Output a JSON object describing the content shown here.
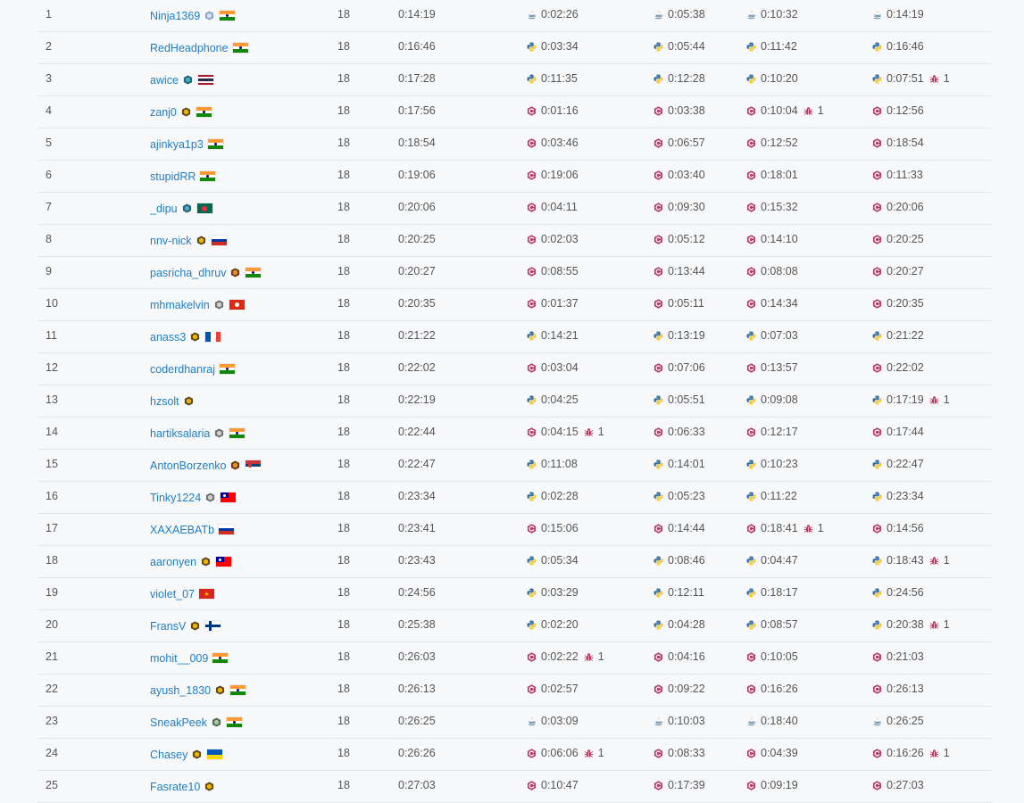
{
  "colors": {
    "link": "#1f7ec7",
    "text": "#555555",
    "bug": "#c0315a",
    "cpp": "#b83a6a",
    "python_blue": "#3572a5",
    "python_yellow": "#f7c93e",
    "java_blue": "#5382a1",
    "java_red": "#e76f00"
  },
  "icons": {
    "cpp": "cpp-language-icon",
    "python3": "python-language-icon",
    "java": "java-language-icon",
    "bug": "wrong-submission-bug-icon"
  },
  "rows": [
    {
      "rank": "1",
      "user": "Ninja1369",
      "badge": "guardian",
      "country": "in",
      "score": "18",
      "time": "0:14:19",
      "subs": [
        {
          "lang": "java",
          "t": "0:02:26",
          "bugs": ""
        },
        {
          "lang": "java",
          "t": "0:05:38",
          "bugs": ""
        },
        {
          "lang": "java",
          "t": "0:10:32",
          "bugs": ""
        },
        {
          "lang": "java",
          "t": "0:14:19",
          "bugs": ""
        }
      ]
    },
    {
      "rank": "2",
      "user": "RedHeadphone",
      "badge": "",
      "country": "in",
      "score": "18",
      "time": "0:16:46",
      "subs": [
        {
          "lang": "python3",
          "t": "0:03:34",
          "bugs": ""
        },
        {
          "lang": "python3",
          "t": "0:05:44",
          "bugs": ""
        },
        {
          "lang": "python3",
          "t": "0:11:42",
          "bugs": ""
        },
        {
          "lang": "python3",
          "t": "0:16:46",
          "bugs": ""
        }
      ]
    },
    {
      "rank": "3",
      "user": "awice",
      "badge": "teal",
      "country": "th",
      "score": "18",
      "time": "0:17:28",
      "subs": [
        {
          "lang": "python3",
          "t": "0:11:35",
          "bugs": ""
        },
        {
          "lang": "python3",
          "t": "0:12:28",
          "bugs": ""
        },
        {
          "lang": "python3",
          "t": "0:10:20",
          "bugs": ""
        },
        {
          "lang": "python3",
          "t": "0:07:51",
          "bugs": "1"
        }
      ]
    },
    {
      "rank": "4",
      "user": "zanj0",
      "badge": "gold",
      "country": "in",
      "score": "18",
      "time": "0:17:56",
      "subs": [
        {
          "lang": "cpp",
          "t": "0:01:16",
          "bugs": ""
        },
        {
          "lang": "cpp",
          "t": "0:03:38",
          "bugs": ""
        },
        {
          "lang": "cpp",
          "t": "0:10:04",
          "bugs": "1"
        },
        {
          "lang": "cpp",
          "t": "0:12:56",
          "bugs": ""
        }
      ]
    },
    {
      "rank": "5",
      "user": "ajinkya1p3",
      "badge": "",
      "country": "in",
      "score": "18",
      "time": "0:18:54",
      "subs": [
        {
          "lang": "cpp",
          "t": "0:03:46",
          "bugs": ""
        },
        {
          "lang": "cpp",
          "t": "0:06:57",
          "bugs": ""
        },
        {
          "lang": "cpp",
          "t": "0:12:52",
          "bugs": ""
        },
        {
          "lang": "cpp",
          "t": "0:18:54",
          "bugs": ""
        }
      ]
    },
    {
      "rank": "6",
      "user": "stupidRR",
      "badge": "",
      "country": "in",
      "score": "18",
      "time": "0:19:06",
      "subs": [
        {
          "lang": "cpp",
          "t": "0:19:06",
          "bugs": ""
        },
        {
          "lang": "cpp",
          "t": "0:03:40",
          "bugs": ""
        },
        {
          "lang": "cpp",
          "t": "0:18:01",
          "bugs": ""
        },
        {
          "lang": "cpp",
          "t": "0:11:33",
          "bugs": ""
        }
      ]
    },
    {
      "rank": "7",
      "user": "_dipu",
      "badge": "teal",
      "country": "bd",
      "score": "18",
      "time": "0:20:06",
      "subs": [
        {
          "lang": "cpp",
          "t": "0:04:11",
          "bugs": ""
        },
        {
          "lang": "cpp",
          "t": "0:09:30",
          "bugs": ""
        },
        {
          "lang": "cpp",
          "t": "0:15:32",
          "bugs": ""
        },
        {
          "lang": "cpp",
          "t": "0:20:06",
          "bugs": ""
        }
      ]
    },
    {
      "rank": "8",
      "user": "nnv-nick",
      "badge": "gold",
      "country": "ru",
      "score": "18",
      "time": "0:20:25",
      "subs": [
        {
          "lang": "cpp",
          "t": "0:02:03",
          "bugs": ""
        },
        {
          "lang": "cpp",
          "t": "0:05:12",
          "bugs": ""
        },
        {
          "lang": "cpp",
          "t": "0:14:10",
          "bugs": ""
        },
        {
          "lang": "cpp",
          "t": "0:20:25",
          "bugs": ""
        }
      ]
    },
    {
      "rank": "9",
      "user": "pasricha_dhruv",
      "badge": "orange",
      "country": "in",
      "score": "18",
      "time": "0:20:27",
      "subs": [
        {
          "lang": "cpp",
          "t": "0:08:55",
          "bugs": ""
        },
        {
          "lang": "cpp",
          "t": "0:13:44",
          "bugs": ""
        },
        {
          "lang": "cpp",
          "t": "0:08:08",
          "bugs": ""
        },
        {
          "lang": "cpp",
          "t": "0:20:27",
          "bugs": ""
        }
      ]
    },
    {
      "rank": "10",
      "user": "mhmakelvin",
      "badge": "silver",
      "country": "hk",
      "score": "18",
      "time": "0:20:35",
      "subs": [
        {
          "lang": "cpp",
          "t": "0:01:37",
          "bugs": ""
        },
        {
          "lang": "cpp",
          "t": "0:05:11",
          "bugs": ""
        },
        {
          "lang": "cpp",
          "t": "0:14:34",
          "bugs": ""
        },
        {
          "lang": "cpp",
          "t": "0:20:35",
          "bugs": ""
        }
      ]
    },
    {
      "rank": "11",
      "user": "anass3",
      "badge": "gold",
      "country": "fr",
      "score": "18",
      "time": "0:21:22",
      "subs": [
        {
          "lang": "python3",
          "t": "0:14:21",
          "bugs": ""
        },
        {
          "lang": "python3",
          "t": "0:13:19",
          "bugs": ""
        },
        {
          "lang": "python3",
          "t": "0:07:03",
          "bugs": ""
        },
        {
          "lang": "python3",
          "t": "0:21:22",
          "bugs": ""
        }
      ]
    },
    {
      "rank": "12",
      "user": "coderdhanraj",
      "badge": "",
      "country": "in",
      "score": "18",
      "time": "0:22:02",
      "subs": [
        {
          "lang": "cpp",
          "t": "0:03:04",
          "bugs": ""
        },
        {
          "lang": "cpp",
          "t": "0:07:06",
          "bugs": ""
        },
        {
          "lang": "cpp",
          "t": "0:13:57",
          "bugs": ""
        },
        {
          "lang": "cpp",
          "t": "0:22:02",
          "bugs": ""
        }
      ]
    },
    {
      "rank": "13",
      "user": "hzsolt",
      "badge": "gold",
      "country": "",
      "score": "18",
      "time": "0:22:19",
      "subs": [
        {
          "lang": "python3",
          "t": "0:04:25",
          "bugs": ""
        },
        {
          "lang": "python3",
          "t": "0:05:51",
          "bugs": ""
        },
        {
          "lang": "python3",
          "t": "0:09:08",
          "bugs": ""
        },
        {
          "lang": "python3",
          "t": "0:17:19",
          "bugs": "1"
        }
      ]
    },
    {
      "rank": "14",
      "user": "hartiksalaria",
      "badge": "silver",
      "country": "in",
      "score": "18",
      "time": "0:22:44",
      "subs": [
        {
          "lang": "cpp",
          "t": "0:04:15",
          "bugs": "1"
        },
        {
          "lang": "cpp",
          "t": "0:06:33",
          "bugs": ""
        },
        {
          "lang": "cpp",
          "t": "0:12:17",
          "bugs": ""
        },
        {
          "lang": "cpp",
          "t": "0:17:44",
          "bugs": ""
        }
      ]
    },
    {
      "rank": "15",
      "user": "AntonBorzenko",
      "badge": "orange",
      "country": "rs",
      "score": "18",
      "time": "0:22:47",
      "subs": [
        {
          "lang": "python3",
          "t": "0:11:08",
          "bugs": ""
        },
        {
          "lang": "python3",
          "t": "0:14:01",
          "bugs": ""
        },
        {
          "lang": "python3",
          "t": "0:10:23",
          "bugs": ""
        },
        {
          "lang": "python3",
          "t": "0:22:47",
          "bugs": ""
        }
      ]
    },
    {
      "rank": "16",
      "user": "Tinky1224",
      "badge": "silver",
      "country": "tw",
      "score": "18",
      "time": "0:23:34",
      "subs": [
        {
          "lang": "python3",
          "t": "0:02:28",
          "bugs": ""
        },
        {
          "lang": "python3",
          "t": "0:05:23",
          "bugs": ""
        },
        {
          "lang": "python3",
          "t": "0:11:22",
          "bugs": ""
        },
        {
          "lang": "python3",
          "t": "0:23:34",
          "bugs": ""
        }
      ]
    },
    {
      "rank": "17",
      "user": "XAXAEBATb",
      "badge": "",
      "country": "ru",
      "score": "18",
      "time": "0:23:41",
      "subs": [
        {
          "lang": "cpp",
          "t": "0:15:06",
          "bugs": ""
        },
        {
          "lang": "cpp",
          "t": "0:14:44",
          "bugs": ""
        },
        {
          "lang": "cpp",
          "t": "0:18:41",
          "bugs": "1"
        },
        {
          "lang": "cpp",
          "t": "0:14:56",
          "bugs": ""
        }
      ]
    },
    {
      "rank": "18",
      "user": "aaronyen",
      "badge": "gold",
      "country": "tw",
      "score": "18",
      "time": "0:23:43",
      "subs": [
        {
          "lang": "python3",
          "t": "0:05:34",
          "bugs": ""
        },
        {
          "lang": "python3",
          "t": "0:08:46",
          "bugs": ""
        },
        {
          "lang": "python3",
          "t": "0:04:47",
          "bugs": ""
        },
        {
          "lang": "python3",
          "t": "0:18:43",
          "bugs": "1"
        }
      ]
    },
    {
      "rank": "19",
      "user": "violet_07",
      "badge": "",
      "country": "vn",
      "score": "18",
      "time": "0:24:56",
      "subs": [
        {
          "lang": "python3",
          "t": "0:03:29",
          "bugs": ""
        },
        {
          "lang": "python3",
          "t": "0:12:11",
          "bugs": ""
        },
        {
          "lang": "python3",
          "t": "0:18:17",
          "bugs": ""
        },
        {
          "lang": "python3",
          "t": "0:24:56",
          "bugs": ""
        }
      ]
    },
    {
      "rank": "20",
      "user": "FransV",
      "badge": "gold",
      "country": "fi",
      "score": "18",
      "time": "0:25:38",
      "subs": [
        {
          "lang": "python3",
          "t": "0:02:20",
          "bugs": ""
        },
        {
          "lang": "python3",
          "t": "0:04:28",
          "bugs": ""
        },
        {
          "lang": "python3",
          "t": "0:08:57",
          "bugs": ""
        },
        {
          "lang": "python3",
          "t": "0:20:38",
          "bugs": "1"
        }
      ]
    },
    {
      "rank": "21",
      "user": "mohit__009",
      "badge": "",
      "country": "in",
      "score": "18",
      "time": "0:26:03",
      "subs": [
        {
          "lang": "cpp",
          "t": "0:02:22",
          "bugs": "1"
        },
        {
          "lang": "cpp",
          "t": "0:04:16",
          "bugs": ""
        },
        {
          "lang": "cpp",
          "t": "0:10:05",
          "bugs": ""
        },
        {
          "lang": "cpp",
          "t": "0:21:03",
          "bugs": ""
        }
      ]
    },
    {
      "rank": "22",
      "user": "ayush_1830",
      "badge": "gold",
      "country": "in",
      "score": "18",
      "time": "0:26:13",
      "subs": [
        {
          "lang": "cpp",
          "t": "0:02:57",
          "bugs": ""
        },
        {
          "lang": "cpp",
          "t": "0:09:22",
          "bugs": ""
        },
        {
          "lang": "cpp",
          "t": "0:16:26",
          "bugs": ""
        },
        {
          "lang": "cpp",
          "t": "0:26:13",
          "bugs": ""
        }
      ]
    },
    {
      "rank": "23",
      "user": "SneakPeek",
      "badge": "green",
      "country": "in",
      "score": "18",
      "time": "0:26:25",
      "subs": [
        {
          "lang": "java",
          "t": "0:03:09",
          "bugs": ""
        },
        {
          "lang": "java",
          "t": "0:10:03",
          "bugs": ""
        },
        {
          "lang": "java",
          "t": "0:18:40",
          "bugs": ""
        },
        {
          "lang": "java",
          "t": "0:26:25",
          "bugs": ""
        }
      ]
    },
    {
      "rank": "24",
      "user": "Chasey",
      "badge": "gold",
      "country": "ua",
      "score": "18",
      "time": "0:26:26",
      "subs": [
        {
          "lang": "cpp",
          "t": "0:06:06",
          "bugs": "1"
        },
        {
          "lang": "cpp",
          "t": "0:08:33",
          "bugs": ""
        },
        {
          "lang": "cpp",
          "t": "0:04:39",
          "bugs": ""
        },
        {
          "lang": "cpp",
          "t": "0:16:26",
          "bugs": "1"
        }
      ]
    },
    {
      "rank": "25",
      "user": "Fasrate10",
      "badge": "gold",
      "country": "",
      "score": "18",
      "time": "0:27:03",
      "subs": [
        {
          "lang": "cpp",
          "t": "0:10:47",
          "bugs": ""
        },
        {
          "lang": "cpp",
          "t": "0:17:39",
          "bugs": ""
        },
        {
          "lang": "cpp",
          "t": "0:09:19",
          "bugs": ""
        },
        {
          "lang": "cpp",
          "t": "0:27:03",
          "bugs": ""
        }
      ]
    }
  ]
}
